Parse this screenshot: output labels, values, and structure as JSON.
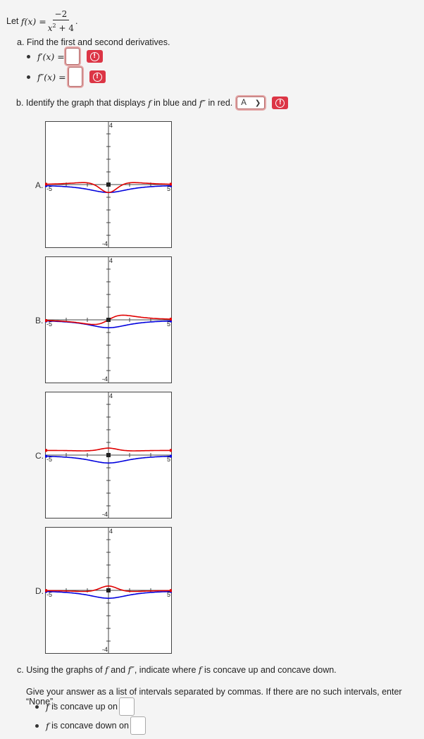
{
  "intro": {
    "let_label": "Let",
    "func_lhs": "f(x) =",
    "numerator": "−2",
    "denominator_base": "x",
    "denominator_exp": "2",
    "denominator_rest": " + 4",
    "trailing": "."
  },
  "part_a": {
    "label": "a. Find the first and second derivatives.",
    "items": [
      {
        "lhs": "f′(x) =",
        "value": "",
        "status": "error"
      },
      {
        "lhs": "f″(x) =",
        "value": "",
        "status": "error"
      }
    ]
  },
  "part_b": {
    "label_prefix": "b. Identify the graph that displays",
    "label_f": "f",
    "label_mid": "in blue and",
    "label_f2": "f″",
    "label_suffix": "in red.",
    "selected": "A",
    "status": "error"
  },
  "graphs": [
    {
      "label": "A."
    },
    {
      "label": "B."
    },
    {
      "label": "C."
    },
    {
      "label": "D."
    }
  ],
  "graph_axes": {
    "xmin": -5,
    "xmax": 5,
    "ymin": -4,
    "ymax": 4,
    "xmin_label": "-5",
    "xmax_label": "5",
    "ymin_label": "-4",
    "ymax_label": "4"
  },
  "colors": {
    "blue": "#0000dd",
    "red": "#e00000",
    "error": "#dc3545"
  },
  "part_c": {
    "label_prefix": "c. Using the graphs of",
    "f": "f",
    "and": "and",
    "f2": "f″",
    "label_mid": ", indicate where",
    "label_suffix": "is concave up and concave down.",
    "hint": "Give your answer as a list of intervals separated by commas. If there are no such intervals, enter “None”.",
    "up_label": "is concave up on",
    "down_label": "is concave down on",
    "up_value": "",
    "down_value": ""
  }
}
